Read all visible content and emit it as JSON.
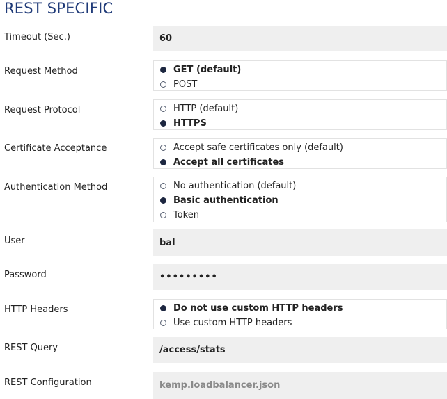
{
  "section_title": "REST SPECIFIC",
  "timeout": {
    "label": "Timeout (Sec.)",
    "value": "60"
  },
  "request_method": {
    "label": "Request Method",
    "options": [
      {
        "label": "GET (default)",
        "selected": true
      },
      {
        "label": "POST",
        "selected": false
      }
    ]
  },
  "request_protocol": {
    "label": "Request Protocol",
    "options": [
      {
        "label": "HTTP (default)",
        "selected": false
      },
      {
        "label": "HTTPS",
        "selected": true
      }
    ]
  },
  "certificate_acceptance": {
    "label": "Certificate Acceptance",
    "options": [
      {
        "label": "Accept safe certificates only (default)",
        "selected": false
      },
      {
        "label": "Accept all certificates",
        "selected": true
      }
    ]
  },
  "authentication_method": {
    "label": "Authentication Method",
    "options": [
      {
        "label": "No authentication (default)",
        "selected": false
      },
      {
        "label": "Basic authentication",
        "selected": true
      },
      {
        "label": "Token",
        "selected": false
      }
    ]
  },
  "user": {
    "label": "User",
    "value": "bal"
  },
  "password": {
    "label": "Password",
    "value": "•••••••••"
  },
  "http_headers": {
    "label": "HTTP Headers",
    "options": [
      {
        "label": "Do not use custom HTTP headers",
        "selected": true
      },
      {
        "label": "Use custom HTTP headers",
        "selected": false
      }
    ]
  },
  "rest_query": {
    "label": "REST Query",
    "value": "/access/stats"
  },
  "rest_configuration": {
    "label": "REST Configuration",
    "value": "kemp.loadbalancer.json"
  }
}
